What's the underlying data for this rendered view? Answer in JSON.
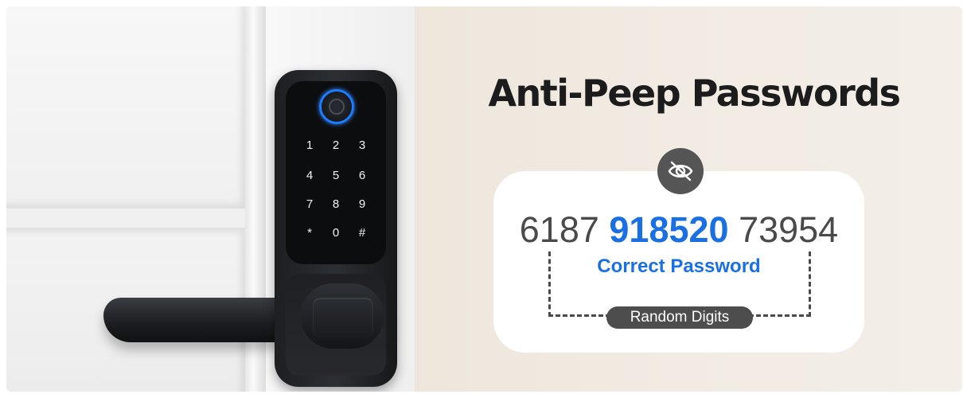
{
  "title": "Anti-Peep Passwords",
  "icons": {
    "badge": "eye-off-icon",
    "sensor": "fingerprint-icon"
  },
  "password": {
    "prefix": "6187",
    "correct": "918520",
    "suffix": "73954",
    "correct_label": "Correct Password",
    "random_label": "Random Digits"
  },
  "keypad": [
    "1",
    "2",
    "3",
    "4",
    "5",
    "6",
    "7",
    "8",
    "9",
    "*",
    "0",
    "#"
  ],
  "colors": {
    "accent": "#1a6fe3",
    "badge": "#555555",
    "title": "#1c1c1c",
    "fingerprint_ring": "#1e7bff"
  }
}
